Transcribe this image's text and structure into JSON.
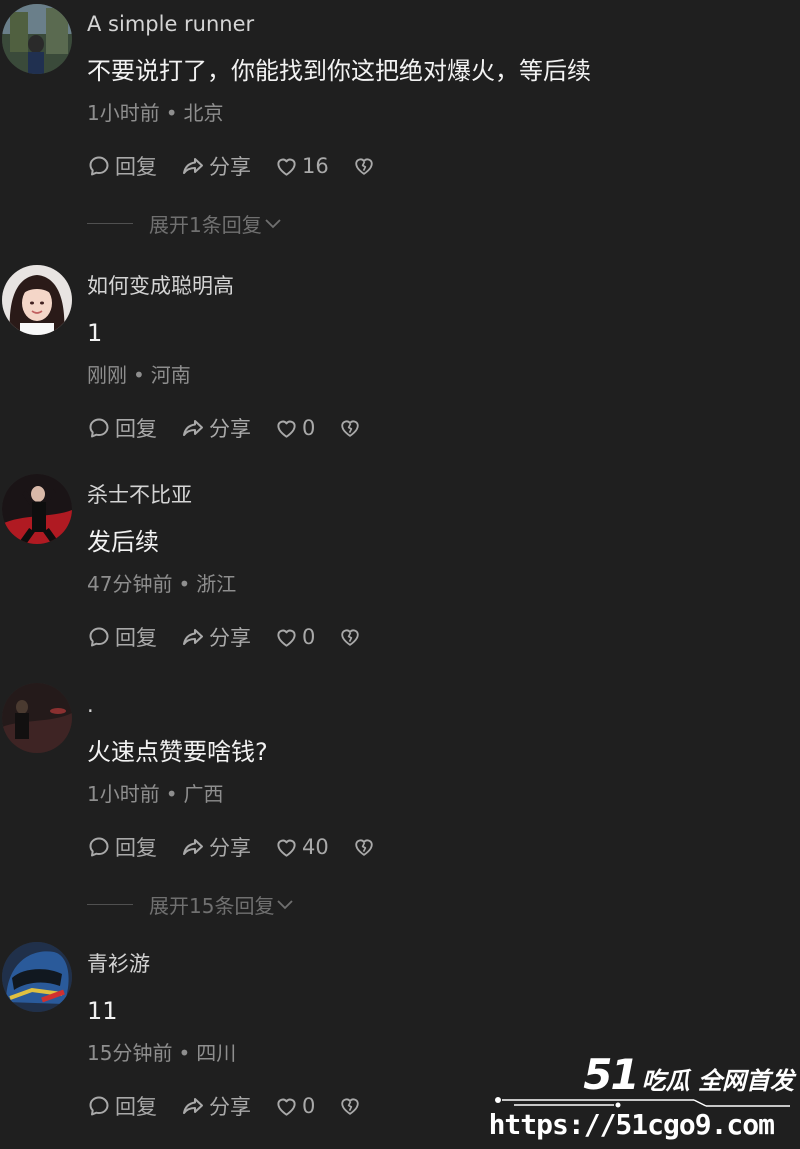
{
  "comments": [
    {
      "username": "A simple runner",
      "text": "不要说打了，你能找到你这把绝对爆火，等后续",
      "time": "1小时前",
      "location": "北京",
      "reply_label": "回复",
      "share_label": "分享",
      "likes": "16",
      "expand_label": "展开1条回复"
    },
    {
      "username": "如何变成聪明高",
      "text": "1",
      "time": "刚刚",
      "location": "河南",
      "reply_label": "回复",
      "share_label": "分享",
      "likes": "0"
    },
    {
      "username": "杀士不比亚",
      "text": "发后续",
      "time": "47分钟前",
      "location": "浙江",
      "reply_label": "回复",
      "share_label": "分享",
      "likes": "0"
    },
    {
      "username": ".",
      "text": "火速点赞要啥钱?",
      "time": "1小时前",
      "location": "广西",
      "reply_label": "回复",
      "share_label": "分享",
      "likes": "40",
      "expand_label": "展开15条回复"
    },
    {
      "username": "青衫游",
      "text": "11",
      "time": "15分钟前",
      "location": "四川",
      "reply_label": "回复",
      "share_label": "分享",
      "likes": "0"
    }
  ],
  "meta_separator": "•",
  "icons": {
    "reply": "comment-bubble-icon",
    "share": "share-arrow-icon",
    "like": "heart-icon",
    "dislike": "broken-heart-icon",
    "expand": "chevron-down-icon"
  },
  "watermark": {
    "number": "51",
    "text": "吃瓜 全网首发",
    "url": "https://51cgo9.com"
  },
  "colors": {
    "background": "#1f1f1f",
    "username": "#d4d4d4",
    "text": "#f2f2f2",
    "meta": "#8e8e8e",
    "action": "#a9a9a9"
  }
}
